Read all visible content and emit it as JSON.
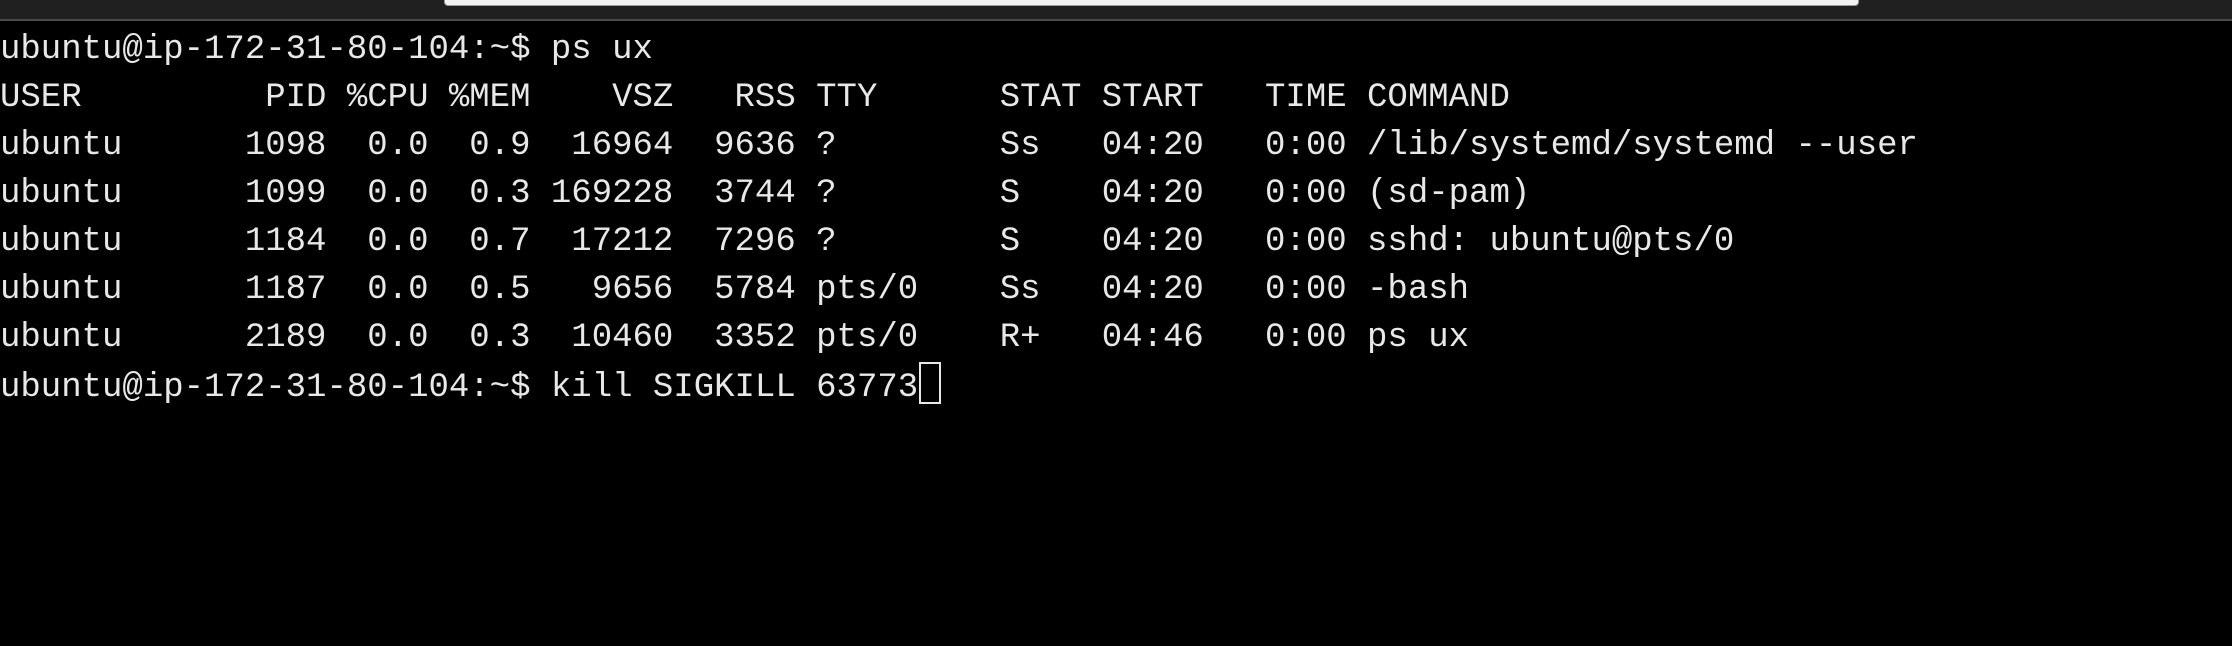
{
  "terminal": {
    "command_prompt": "ubuntu@ip-172-31-80-104:~$ ps ux",
    "header": "USER         PID %CPU %MEM    VSZ   RSS TTY      STAT START   TIME COMMAND",
    "processes": [
      "ubuntu      1098  0.0  0.9  16964  9636 ?        Ss   04:20   0:00 /lib/systemd/systemd --user",
      "ubuntu      1099  0.0  0.3 169228  3744 ?        S    04:20   0:00 (sd-pam)",
      "ubuntu      1184  0.0  0.7  17212  7296 ?        S    04:20   0:00 sshd: ubuntu@pts/0",
      "ubuntu      1187  0.0  0.5   9656  5784 pts/0    Ss   04:20   0:00 -bash",
      "ubuntu      2189  0.0  0.3  10460  3352 pts/0    R+   04:46   0:00 ps ux"
    ],
    "current_input": "ubuntu@ip-172-31-80-104:~$ kill SIGKILL 63773"
  }
}
